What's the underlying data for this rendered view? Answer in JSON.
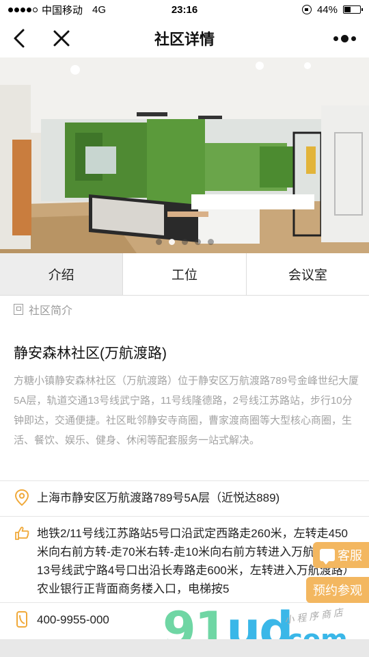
{
  "status_bar": {
    "carrier": "中国移动",
    "network": "4G",
    "time": "23:16",
    "battery": "44%",
    "battery_level": 0.44
  },
  "nav": {
    "title": "社区详情",
    "back_icon": "chevron-left-icon",
    "close_icon": "close-icon",
    "more_icon": "more-dots-icon"
  },
  "banner": {
    "image": "office-green-wall-photo",
    "slide_count": 5,
    "active_slide": 1
  },
  "tabs": [
    {
      "label": "介绍",
      "active": true
    },
    {
      "label": "工位",
      "active": false
    },
    {
      "label": "会议室",
      "active": false
    }
  ],
  "intro": {
    "section_label": "社区简介",
    "name": "静安森林社区(万航渡路)",
    "description": "方糖小镇静安森林社区（万航渡路）位于静安区万航渡路789号金峰世纪大厦5A层，轨道交通13号线武宁路，11号线隆德路，2号线江苏路站，步行10分钟即达，交通便捷。社区毗邻静安寺商圈，曹家渡商圈等大型核心商圈，生活、餐饮、娱乐、健身、休闲等配套服务一站式解决。"
  },
  "address": {
    "icon": "location-pin-icon",
    "text": "上海市静安区万航渡路789号5A层（近悦达889)"
  },
  "directions": {
    "icon": "hand-pointing-icon",
    "text": "地铁2/11号线江苏路站5号口沿武定西路走260米，左转走450米向右前方转-走70米右转-走10米向右前方转进入万航渡路；13号线武宁路4号口出沿长寿路走600米，左转进入万航渡路）农业银行正背面商务楼入口，电梯按5"
  },
  "phone": {
    "icon": "phone-icon",
    "number": "400-9955-000"
  },
  "floating": {
    "service_label": "客服",
    "booking_label": "预约参观"
  },
  "watermark": {
    "part1": "91",
    "part2": "ud",
    "part3": ".com",
    "sub": "小程序商店"
  },
  "colors": {
    "accent": "#f3b760",
    "tab_active_bg": "#ededed",
    "desc_text": "#a3a3a3"
  }
}
